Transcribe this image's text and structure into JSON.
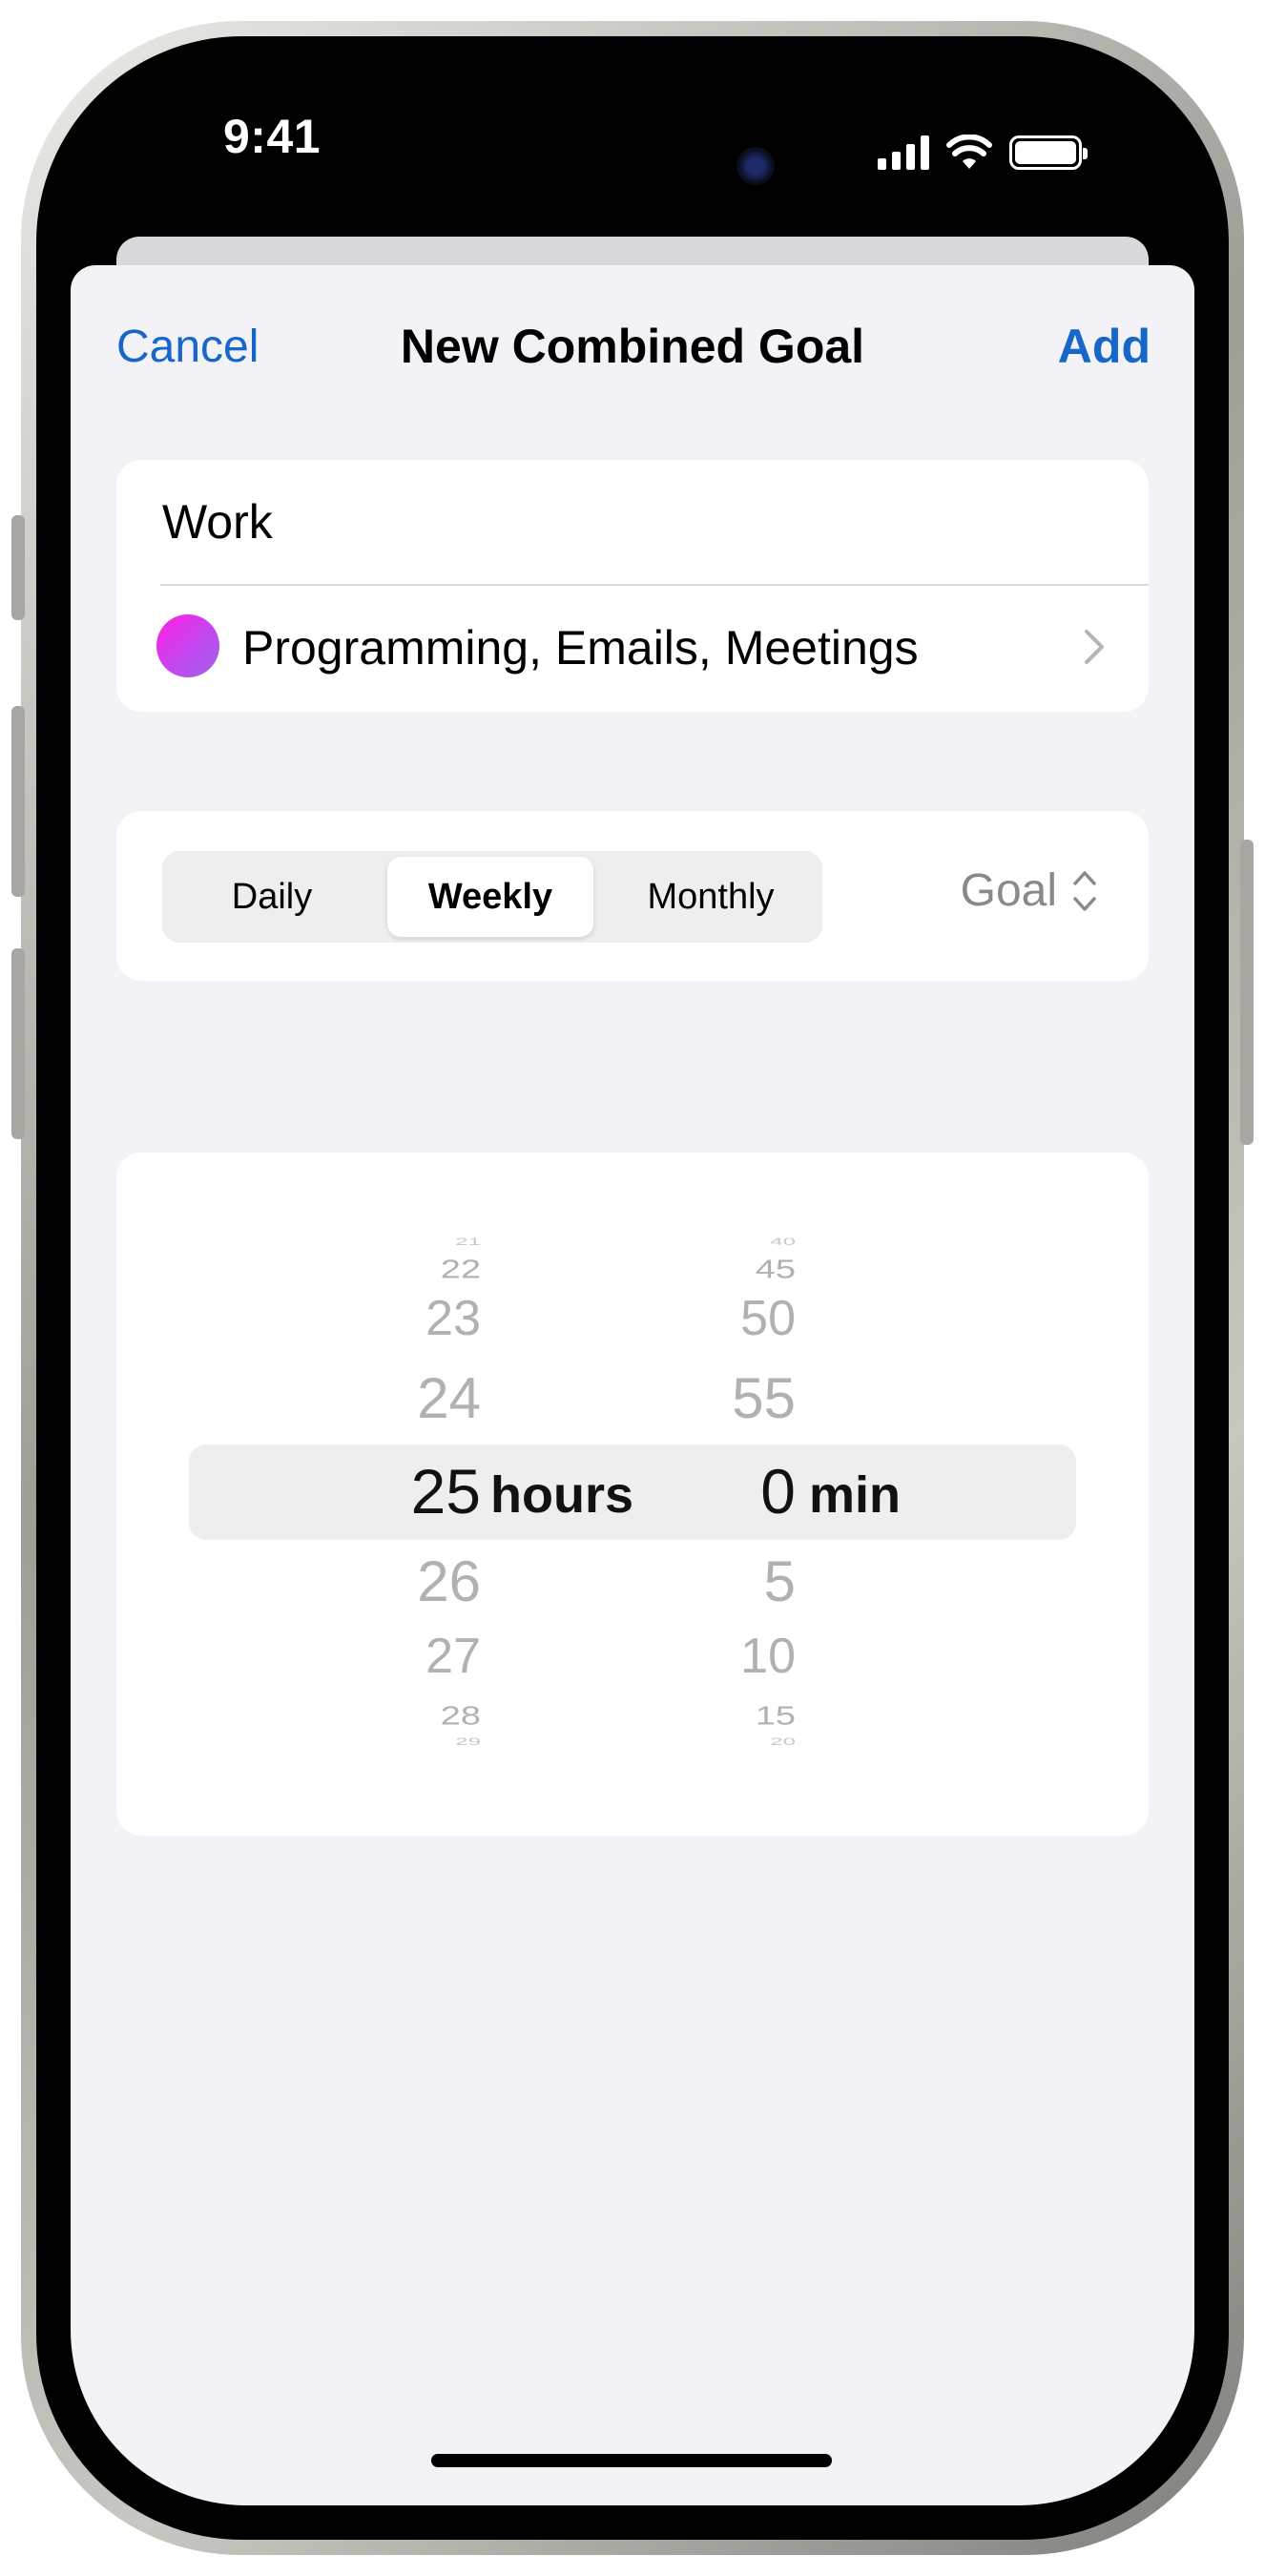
{
  "status_bar": {
    "time": "9:41"
  },
  "nav": {
    "cancel": "Cancel",
    "title": "New Combined Goal",
    "add": "Add"
  },
  "goal": {
    "name": "Work",
    "apps": "Programming, Emails, Meetings",
    "dot_color": "#e02ee8"
  },
  "period": {
    "options": [
      "Daily",
      "Weekly",
      "Monthly"
    ],
    "selected": "Weekly"
  },
  "goal_menu": {
    "label": "Goal"
  },
  "picker": {
    "hours": {
      "above": [
        "21",
        "22",
        "23",
        "24"
      ],
      "selected": "25",
      "below": [
        "26",
        "27",
        "28",
        "29"
      ],
      "unit": "hours"
    },
    "minutes": {
      "above": [
        "40",
        "45",
        "50",
        "55"
      ],
      "selected": "0",
      "below": [
        "5",
        "10",
        "15",
        "20"
      ],
      "unit": "min"
    }
  },
  "colors": {
    "accent": "#1766c9",
    "background": "#f2f2f7",
    "secondary_text": "#8a8a8e"
  }
}
